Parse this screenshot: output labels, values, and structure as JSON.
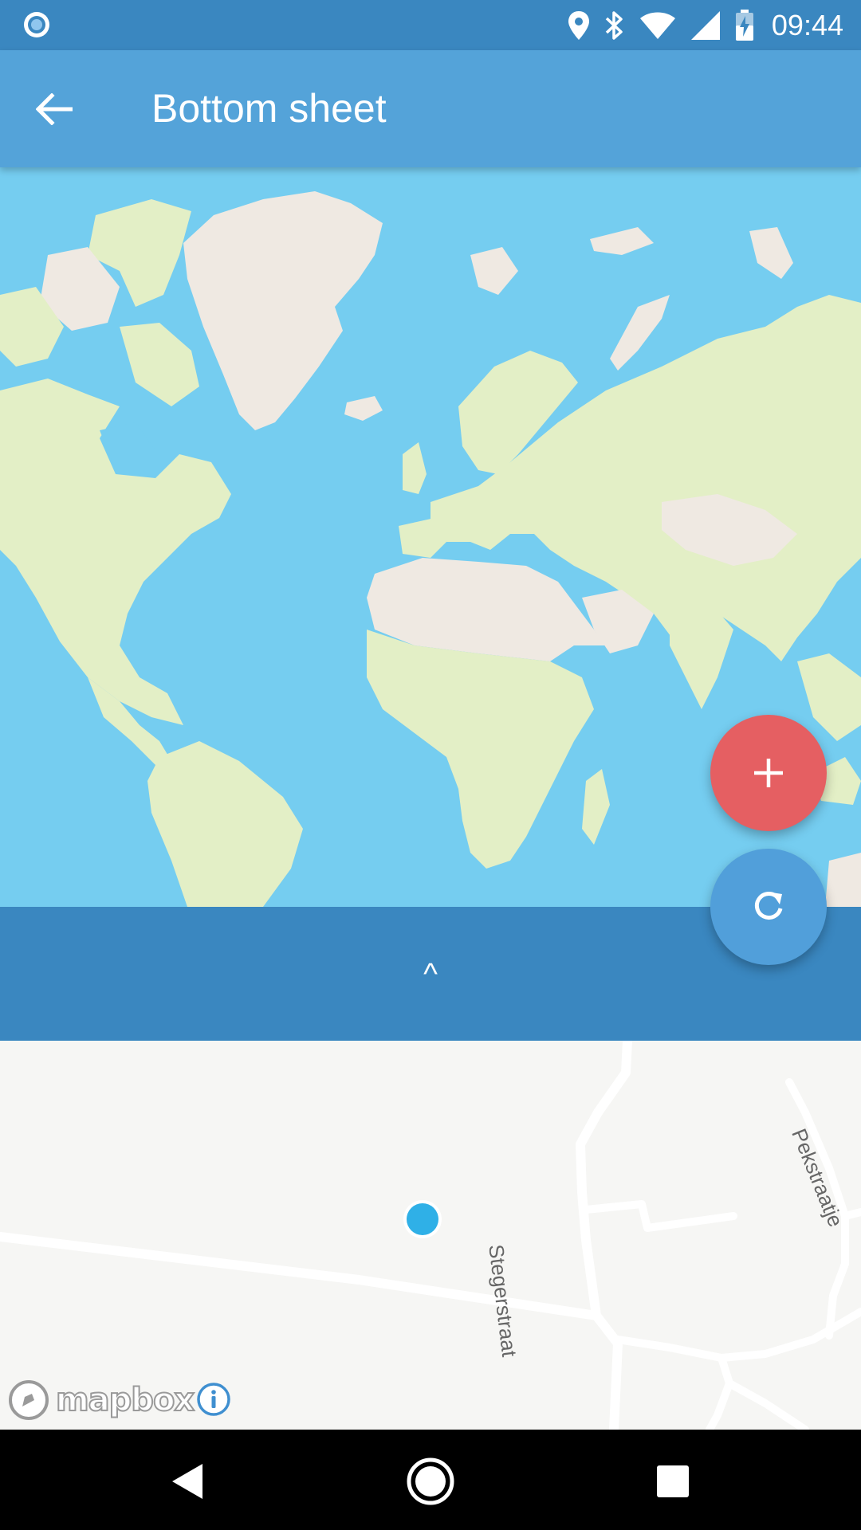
{
  "status_bar": {
    "time": "09:44",
    "icons": [
      "recording-icon",
      "location-icon",
      "bluetooth-icon",
      "wifi-icon",
      "signal-icon",
      "battery-charging-icon"
    ]
  },
  "app_bar": {
    "title": "Bottom sheet",
    "back_icon": "arrow-back-icon"
  },
  "bottom_sheet": {
    "toggle_label": "^"
  },
  "fabs": {
    "add_icon": "plus-icon",
    "add_color": "#e55f62",
    "refresh_icon": "refresh-icon",
    "refresh_color": "#519fda"
  },
  "detail_map": {
    "streets": [
      "Stegerstraat",
      "Pekstraatje"
    ],
    "attribution": "mapbox",
    "info_icon": "info-icon"
  },
  "colors": {
    "status_bar": "#3a87c0",
    "app_bar": "#54a3d9",
    "ocean": "#75cdf0",
    "land_green": "#e3efc6",
    "land_beige": "#efe9e2",
    "sheet_bar": "#3a87c0",
    "location_dot": "#2fb0e7"
  },
  "nav_bar": {
    "icons": [
      "nav-back-icon",
      "nav-home-icon",
      "nav-recents-icon"
    ]
  }
}
